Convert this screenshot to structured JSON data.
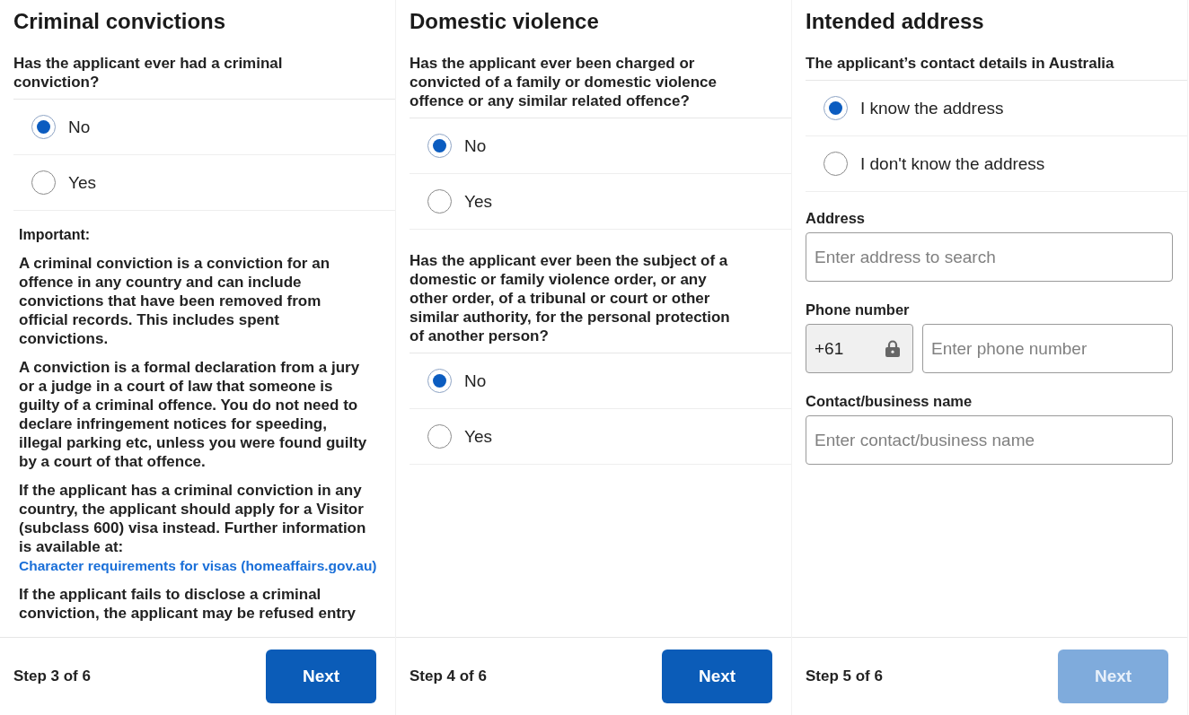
{
  "panels": [
    {
      "title": "Criminal convictions",
      "sections": [
        {
          "kind": "question",
          "question": "Has the applicant ever had a criminal conviction?",
          "options": [
            {
              "label": "No",
              "selected": true
            },
            {
              "label": "Yes",
              "selected": false
            }
          ]
        },
        {
          "kind": "info",
          "heading": "Important:",
          "paragraphs": [
            {
              "text": "A criminal conviction is a conviction for an offence in any country and can include convictions that have been removed from official records. This includes spent convictions."
            },
            {
              "text": "A conviction is a formal declaration from a jury or a judge in a court of law that someone is guilty of a criminal offence. You do not need to declare infringement notices for speeding, illegal parking etc, unless you were found guilty by a court of that offence."
            },
            {
              "text": "If the applicant has a criminal conviction in any country, the applicant should apply for a Visitor (subclass 600) visa instead. Further information is available at:",
              "link": "Character requirements for visas (homeaffairs.gov.au)"
            },
            {
              "text": "If the applicant fails to disclose a criminal conviction, the applicant may be refused entry"
            }
          ]
        }
      ],
      "footer": {
        "step": "Step 3 of 6",
        "button": {
          "label": "Next",
          "disabled": false
        }
      }
    },
    {
      "title": "Domestic violence",
      "sections": [
        {
          "kind": "question",
          "question": "Has the applicant ever been charged or convicted of a family or domestic violence offence or any similar related offence?",
          "options": [
            {
              "label": "No",
              "selected": true
            },
            {
              "label": "Yes",
              "selected": false
            }
          ]
        },
        {
          "kind": "question",
          "question": "Has the applicant ever been the subject of a domestic or family violence order, or any other order, of a tribunal or court or other similar authority, for the personal protection of another person?",
          "options": [
            {
              "label": "No",
              "selected": true
            },
            {
              "label": "Yes",
              "selected": false
            }
          ]
        }
      ],
      "footer": {
        "step": "Step 4 of 6",
        "button": {
          "label": "Next",
          "disabled": false
        }
      }
    },
    {
      "title": "Intended address",
      "sections": [
        {
          "kind": "question",
          "question": "The applicant’s contact details in Australia",
          "options": [
            {
              "label": "I know the address",
              "selected": true
            },
            {
              "label": "I don't know the address",
              "selected": false
            }
          ]
        },
        {
          "kind": "fields",
          "fields": [
            {
              "label": "Address",
              "inputs": [
                {
                  "kind": "text",
                  "placeholder": "Enter address to search"
                }
              ]
            },
            {
              "label": "Phone number",
              "inputs": [
                {
                  "kind": "prefix",
                  "value": "+61",
                  "locked": true
                },
                {
                  "kind": "text",
                  "placeholder": "Enter phone number"
                }
              ]
            },
            {
              "label": "Contact/business name",
              "inputs": [
                {
                  "kind": "text",
                  "placeholder": "Enter contact/business name"
                }
              ]
            }
          ]
        }
      ],
      "footer": {
        "step": "Step 5 of 6",
        "button": {
          "label": "Next",
          "disabled": true
        }
      }
    }
  ]
}
